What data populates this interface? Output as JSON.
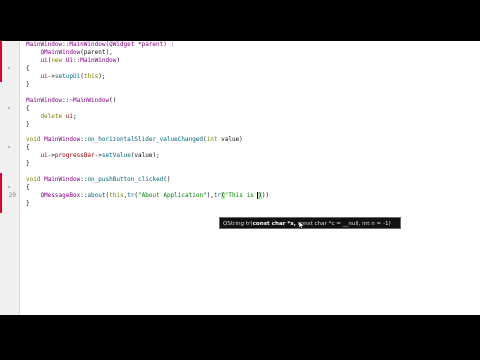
{
  "editor": {
    "lines": [
      {
        "gutter": "",
        "parts": [
          {
            "t": "MainWindow::MainWindow(QWidget *parent) :",
            "c": "cls"
          }
        ]
      },
      {
        "gutter": "",
        "parts": [
          {
            "t": "    QMainWindow",
            "c": "cls"
          },
          {
            "t": "(parent),",
            "c": ""
          }
        ]
      },
      {
        "gutter": "",
        "parts": [
          {
            "t": "    ui",
            "c": "mem"
          },
          {
            "t": "(",
            "c": ""
          },
          {
            "t": "new",
            "c": "kw"
          },
          {
            "t": " Ui::MainWindow",
            "c": "cls"
          },
          {
            "t": ")",
            "c": ""
          }
        ]
      },
      {
        "gutter": "",
        "parts": [
          {
            "t": "{",
            "c": ""
          }
        ]
      },
      {
        "gutter": "",
        "parts": [
          {
            "t": "    ui",
            "c": "mem"
          },
          {
            "t": "->",
            "c": ""
          },
          {
            "t": "setupUi",
            "c": "fn"
          },
          {
            "t": "(",
            "c": ""
          },
          {
            "t": "this",
            "c": "kw"
          },
          {
            "t": ");",
            "c": ""
          }
        ]
      },
      {
        "gutter": "",
        "parts": [
          {
            "t": "}",
            "c": ""
          }
        ]
      },
      {
        "gutter": "",
        "parts": [
          {
            "t": "",
            "c": ""
          }
        ]
      },
      {
        "gutter": "",
        "parts": [
          {
            "t": "MainWindow",
            "c": "cls"
          },
          {
            "t": "::",
            "c": ""
          },
          {
            "t": "~MainWindow",
            "c": "cls"
          },
          {
            "t": "()",
            "c": ""
          }
        ]
      },
      {
        "gutter": "",
        "parts": [
          {
            "t": "{",
            "c": ""
          }
        ]
      },
      {
        "gutter": "",
        "parts": [
          {
            "t": "    delete",
            "c": "kw"
          },
          {
            "t": " ",
            "c": ""
          },
          {
            "t": "ui",
            "c": "mem"
          },
          {
            "t": ";",
            "c": ""
          }
        ]
      },
      {
        "gutter": "",
        "parts": [
          {
            "t": "}",
            "c": ""
          }
        ]
      },
      {
        "gutter": "",
        "parts": [
          {
            "t": "",
            "c": ""
          }
        ]
      },
      {
        "gutter": "",
        "parts": [
          {
            "t": "void",
            "c": "kw"
          },
          {
            "t": " ",
            "c": ""
          },
          {
            "t": "MainWindow",
            "c": "cls"
          },
          {
            "t": "::",
            "c": ""
          },
          {
            "t": "on_horizontalSlider_valueChanged",
            "c": "fn"
          },
          {
            "t": "(",
            "c": ""
          },
          {
            "t": "int",
            "c": "kw"
          },
          {
            "t": " value)",
            "c": ""
          }
        ]
      },
      {
        "gutter": "",
        "parts": [
          {
            "t": "{",
            "c": ""
          }
        ]
      },
      {
        "gutter": "",
        "parts": [
          {
            "t": "    ui",
            "c": "mem"
          },
          {
            "t": "->",
            "c": ""
          },
          {
            "t": "progressBar",
            "c": "mem"
          },
          {
            "t": "->",
            "c": ""
          },
          {
            "t": "setValue",
            "c": "fn"
          },
          {
            "t": "(value);",
            "c": ""
          }
        ]
      },
      {
        "gutter": "",
        "parts": [
          {
            "t": "}",
            "c": ""
          }
        ]
      },
      {
        "gutter": "",
        "parts": [
          {
            "t": "",
            "c": ""
          }
        ]
      },
      {
        "gutter": "",
        "parts": [
          {
            "t": "void",
            "c": "kw"
          },
          {
            "t": " ",
            "c": ""
          },
          {
            "t": "MainWindow",
            "c": "cls"
          },
          {
            "t": "::",
            "c": ""
          },
          {
            "t": "on_pushButton_clicked",
            "c": "fn"
          },
          {
            "t": "()",
            "c": ""
          }
        ]
      },
      {
        "gutter": "",
        "parts": [
          {
            "t": "{",
            "c": ""
          }
        ]
      },
      {
        "gutter": "20",
        "parts": [
          {
            "t": "    QMessageBox",
            "c": "cls"
          },
          {
            "t": "::",
            "c": ""
          },
          {
            "t": "about",
            "c": "fn"
          },
          {
            "t": "(",
            "c": ""
          },
          {
            "t": "this",
            "c": "kw"
          },
          {
            "t": ",",
            "c": ""
          },
          {
            "t": "tr",
            "c": "fn"
          },
          {
            "t": "(",
            "c": ""
          },
          {
            "t": "\"About Application\"",
            "c": "str"
          },
          {
            "t": "),",
            "c": ""
          },
          {
            "t": "tr",
            "c": "fn"
          },
          {
            "t": "(",
            "c": "hl"
          },
          {
            "t": "\"This is ",
            "c": "str"
          },
          {
            "t": "|",
            "c": "cursor"
          },
          {
            "t": ")",
            "c": "hl"
          },
          {
            "t": "))",
            "c": ""
          }
        ]
      },
      {
        "gutter": "",
        "parts": [
          {
            "t": "}",
            "c": ""
          }
        ]
      }
    ]
  },
  "tooltip": {
    "return_type": "QString tr(",
    "current_param": "const char *s,",
    "rest": " const char *c = __null, int n = -1)"
  },
  "colors": {
    "background": "#ffffff",
    "letterbox": "#000000",
    "gutter": "#f0f0f0",
    "change_marker": "#c8102e",
    "class": "#800080",
    "keyword": "#808000",
    "function": "#00677c",
    "string": "#008000",
    "member": "#800000"
  }
}
